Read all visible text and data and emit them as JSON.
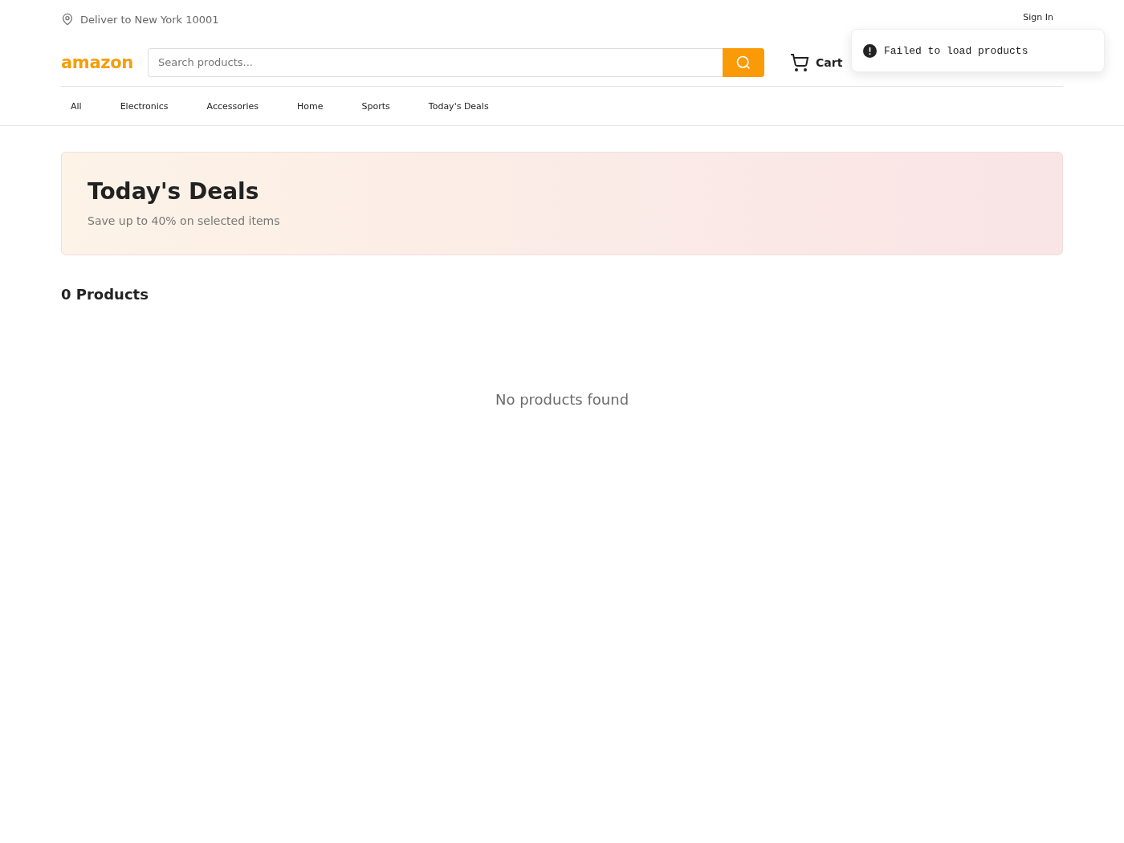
{
  "header": {
    "delivery": "Deliver to New York 10001",
    "sign_in": "Sign In",
    "logo": "amazon",
    "search": {
      "placeholder": "Search products..."
    },
    "cart": "Cart"
  },
  "nav": [
    "All",
    "Electronics",
    "Accessories",
    "Home",
    "Sports",
    "Today's Deals"
  ],
  "banner": {
    "title": "Today's Deals",
    "subtitle": "Save up to 40% on selected items"
  },
  "products": {
    "count": "0 Products",
    "empty": "No products found"
  },
  "toast": {
    "kind": "error",
    "message": "Failed to load products"
  }
}
